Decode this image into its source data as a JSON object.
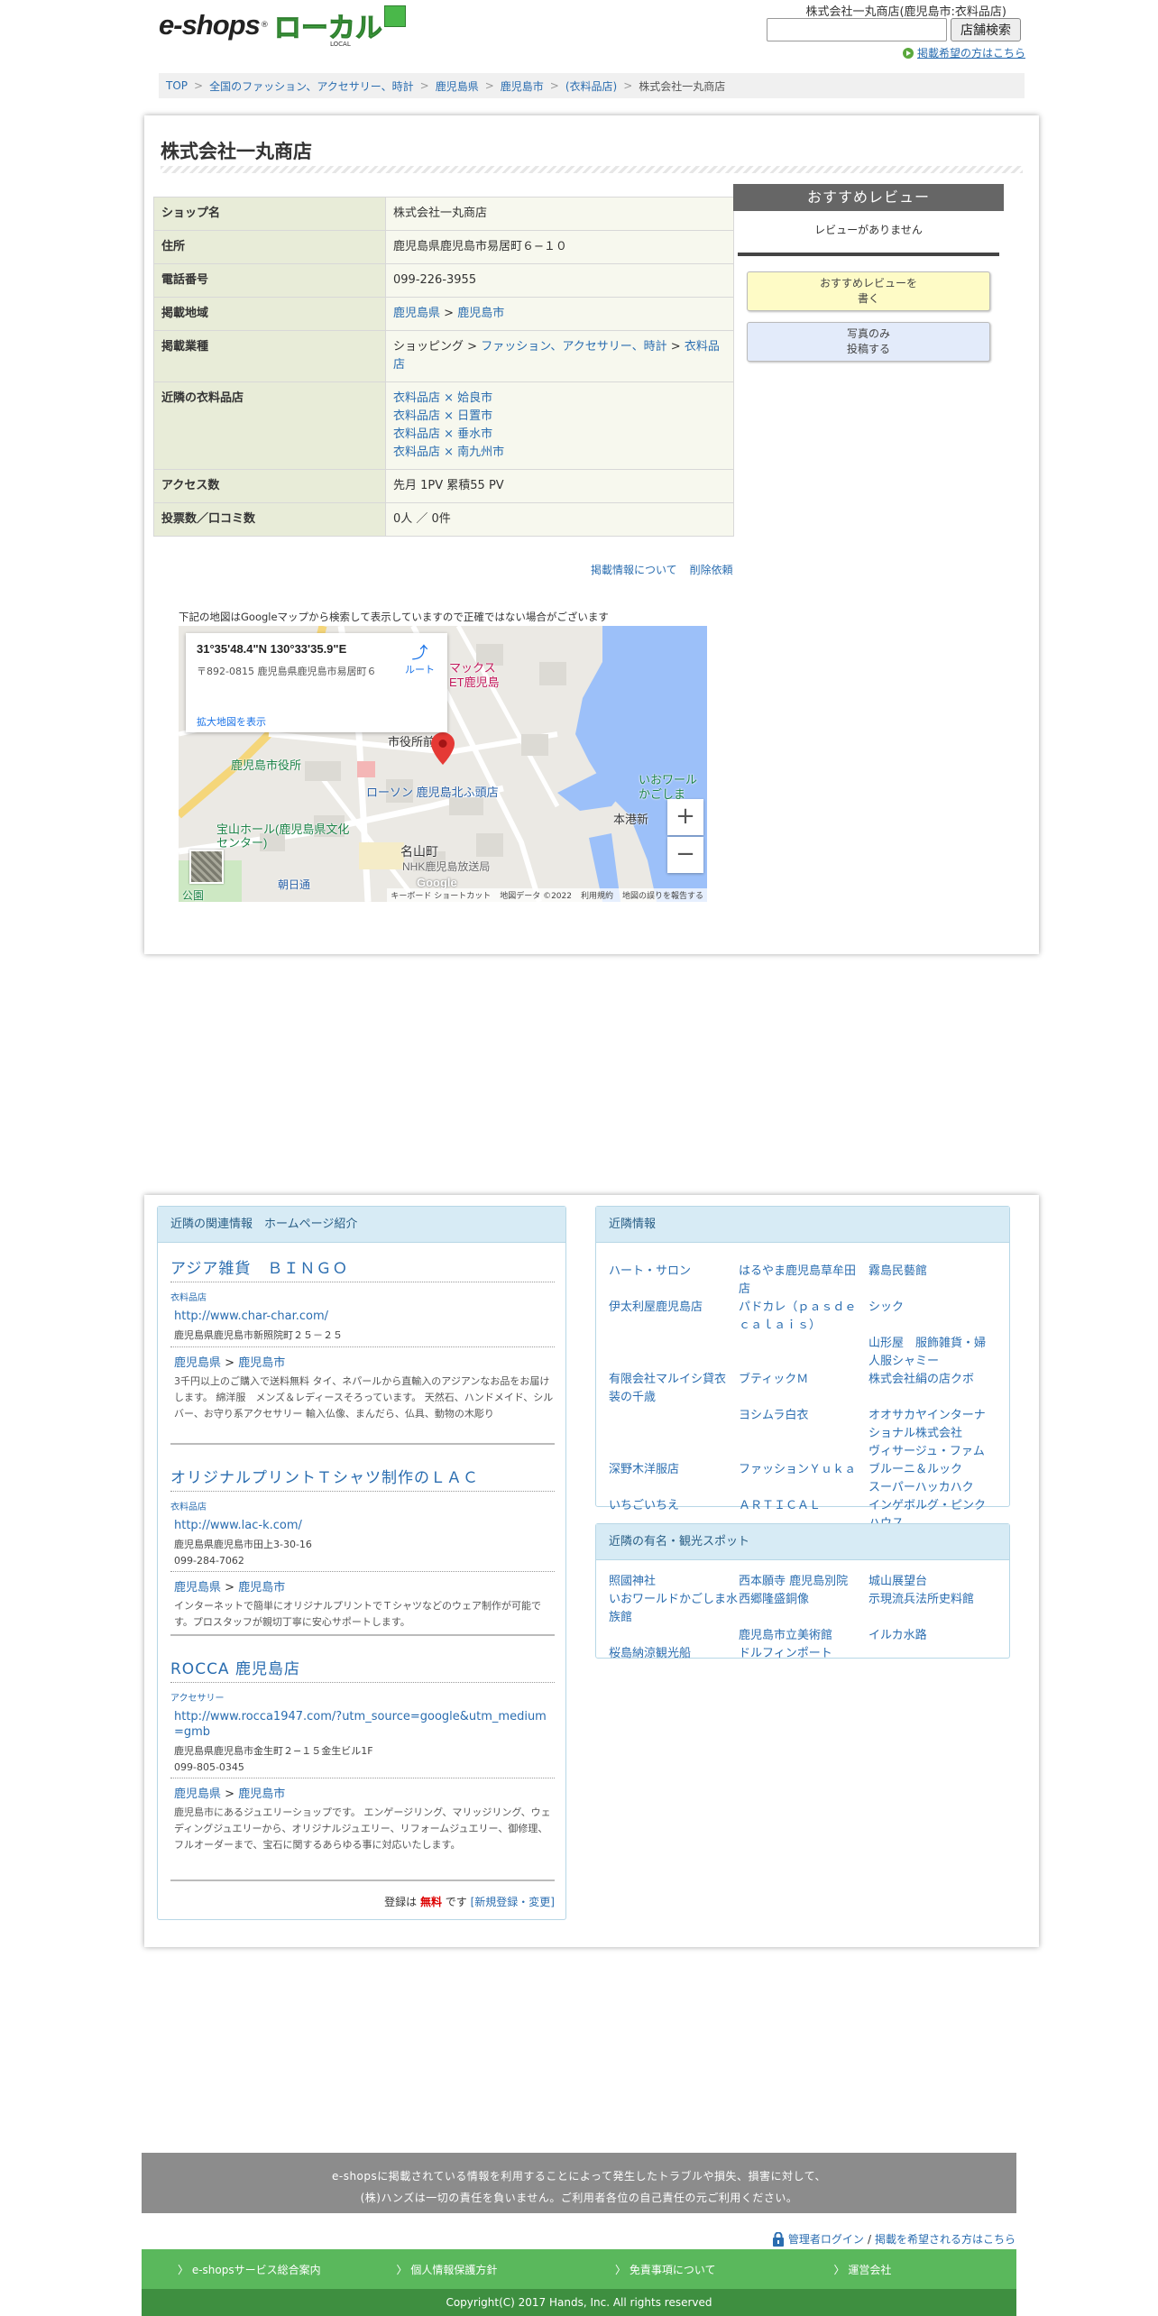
{
  "header": {
    "logo_text": "e-shops",
    "logo_mark": "®",
    "logo_local": "ローカル",
    "logo_sub": "LOCAL",
    "shop_label": "株式会社一丸商店(鹿児島市:衣料品店)",
    "search_placeholder": "",
    "search_button": "店舗検索",
    "listing_request": "掲載希望の方はこちら"
  },
  "breadcrumb": [
    "TOP",
    "全国のファッション、アクセサリー、時計",
    "鹿児島県",
    "鹿児島市",
    "(衣料品店)",
    "株式会社一丸商店"
  ],
  "shop": {
    "title": "株式会社一丸商店",
    "rows": {
      "name_label": "ショップ名",
      "name": "株式会社一丸商店",
      "address_label": "住所",
      "address": "鹿児島県鹿児島市易居町６−１０",
      "phone_label": "電話番号",
      "phone": "099-226-3955",
      "area_label": "掲載地域",
      "area_pref": "鹿児島県",
      "area_gt": ">",
      "area_city": "鹿児島市",
      "biz_label": "掲載業種",
      "biz_1": "ショッピング",
      "biz_gt1": ">",
      "biz_2": "ファッション、アクセサリー、時計",
      "biz_gt2": ">",
      "biz_3": "衣料品店",
      "nearby_label": "近隣の衣料品店",
      "nearby_1": "衣料品店 × 姶良市",
      "nearby_2": "衣料品店 × 日置市",
      "nearby_3": "衣料品店 × 垂水市",
      "nearby_4": "衣料品店 × 南九州市",
      "access_label": "アクセス数",
      "access": "先月 1PV 累積55 PV",
      "votes_label": "投票数／口コミ数",
      "votes": "0人 ／ 0件"
    },
    "link_about": "掲載情報について",
    "link_delete": "削除依頼"
  },
  "map": {
    "note": "下記の地図はGoogleマップから検索して表示していますので正確ではない場合がございます",
    "coords": "31°35'48.4\"N 130°33'35.9\"E",
    "address": "〒892-0815 鹿児島県鹿児島市易居町６",
    "route": "ルート",
    "enlarge": "拡大地図を表示",
    "zoom_in": "+",
    "zoom_out": "−",
    "google": "Google",
    "footer_keys": "キーボード ショートカット",
    "footer_data": "地図データ ©2022",
    "footer_terms": "利用規約",
    "footer_report": "地図の誤りを報告する",
    "labels": {
      "city_hall": "鹿児島市役所",
      "city_hall_mae": "市役所前",
      "lawson": "ローソン 鹿児島北ふ頭店",
      "hoshi": "宝山ホール(鹿児島県文化センター)",
      "nayama": "名山町",
      "nhk": "NHK鹿児島放送局",
      "asahi": "朝日通",
      "maruya": "マックス",
      "maruya2": "ET鹿児島",
      "iowa": "いおワール",
      "iowa2": "かごしま",
      "honko": "本港新",
      "park": "公園"
    },
    "accent_pin": "#e53935",
    "water_color": "#9cc0f9"
  },
  "review": {
    "header": "おすすめレビュー",
    "none": "レビューがありません",
    "write_line1": "おすすめレビューを",
    "write_line2": "書く",
    "photo_line1": "写真のみ",
    "photo_line2": "投稿する"
  },
  "related": {
    "header": "近隣の関連情報　ホームページ紹介",
    "items": [
      {
        "name": "アジア雑貨　ＢＩＮＧＯ",
        "category": "衣料品店",
        "url": "http://www.char-char.com/",
        "address": "鹿児島県鹿児島市新照院町２５－２５",
        "tel": "",
        "pref": "鹿児島県",
        "gt": ">",
        "city": "鹿児島市",
        "desc": "3千円以上のご購入で送料無料 タイ、ネパールから直輸入のアジアンなお品をお届けします。 綿洋服　メンズ＆レディースそろっています。 天然石、ハンドメイド、シルバー、お守り系アクセサリー 輸入仏像、まんだら、仏具、動物の木彫り"
      },
      {
        "name": "オリジナルプリントＴシャツ制作のＬＡＣ",
        "category": "衣料品店",
        "url": "http://www.lac-k.com/",
        "address": "鹿児島県鹿児島市田上3-30-16",
        "tel": "099-284-7062",
        "pref": "鹿児島県",
        "gt": ">",
        "city": "鹿児島市",
        "desc": "インターネットで簡単にオリジナルプリントでＴシャツなどのウェア制作が可能です。プロスタッフが親切丁寧に安心サポートします。"
      },
      {
        "name": "ROCCA 鹿児島店",
        "category": "アクセサリー",
        "url": "http://www.rocca1947.com/?utm_source=google&utm_medium=gmb",
        "address": "鹿児島県鹿児島市金生町２−１５金生ビル1F",
        "tel": "099-805-0345",
        "pref": "鹿児島県",
        "gt": ">",
        "city": "鹿児島市",
        "desc": "鹿児島市にあるジュエリーショップです。 エンゲージリング、マリッジリング、ウェディングジュエリーから、オリジナルジュエリー、リフォームジュエリー、御修理、フルオーダーまで、宝石に関するあらゆる事に対応いたします。"
      }
    ],
    "free_prefix": "登録は",
    "free_word": "無料",
    "free_suffix": "です",
    "register_link": "[新規登録・変更]"
  },
  "nearby": {
    "header": "近隣情報",
    "cells": [
      "ハート・サロン",
      "はるやま鹿児島草牟田店",
      "霧島民藝館",
      "伊太利屋鹿児島店",
      "パドカレ（ｐａｓｄｅｃａｌａｉｓ）",
      "シック",
      "",
      "",
      "山形屋　服飾雑貨・婦人服シャミー",
      "有限会社マルイシ貸衣装の千歳",
      "ブティックＭ",
      "株式会社絹の店クボ",
      "",
      "ヨシムラ白衣",
      "オオサカヤインターナショナル株式会社",
      "",
      "",
      "ヴィサージュ・ファム",
      "深野木洋服店",
      "ファッションＹｕｋａ",
      "ブルーニ＆ルック",
      "",
      "",
      "スーパーハッカハク",
      "いちごいちえ",
      "ＡＲＴＩＣＡＬ",
      "インゲボルグ・ピンクハウス"
    ]
  },
  "spots": {
    "header": "近隣の有名・観光スポット",
    "cells": [
      "照國神社",
      "西本願寺 鹿児島別院",
      "城山展望台",
      "いおワールドかごしま水族館",
      "西郷隆盛銅像",
      "示現流兵法所史料館",
      "",
      "鹿児島市立美術館",
      "イルカ水路",
      "桜島納涼観光船",
      "ドルフィンポート",
      ""
    ]
  },
  "footer": {
    "disclaimer_1": "e-shopsに掲載されている情報を利用することによって発生したトラブルや損失、損害に対して、",
    "disclaimer_2": "(株)ハンズは一切の責任を負いません。ご利用者各位の自己責任の元ご利用ください。",
    "admin_login": "管理者ログイン",
    "slash": "/",
    "listing_wish": "掲載を希望される方はこちら",
    "nav": [
      "e-shopsサービス総合案内",
      "個人情報保護方針",
      "免責事項について",
      "運営会社"
    ],
    "copyright": "Copyright(C) 2017 Hands, Inc. All rights reserved"
  }
}
